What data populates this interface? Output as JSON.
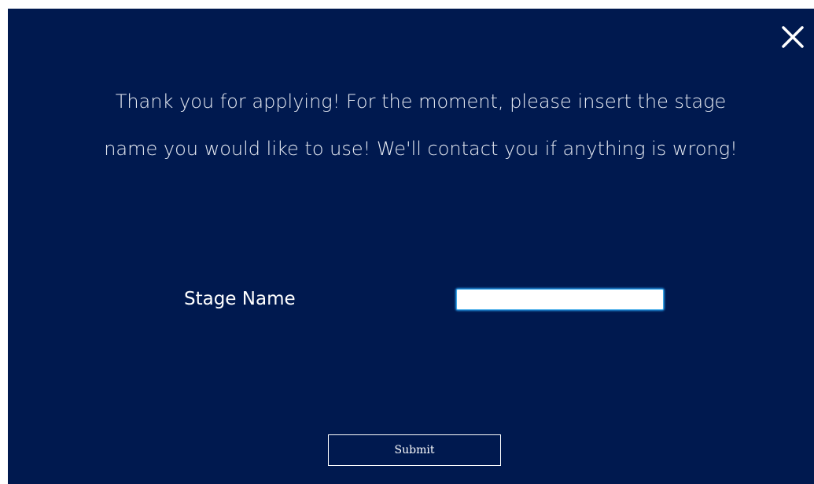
{
  "dialog": {
    "message": "Thank you for applying! For the moment, please insert the stage name you would like to use! We'll contact you if anything is wrong!",
    "field_label": "Stage Name",
    "field_value": "",
    "submit_label": "Submit",
    "close_icon": "close-icon"
  },
  "colors": {
    "background": "#00194f",
    "text": "#ffffff",
    "input_focus_border": "#3ba6e8"
  }
}
